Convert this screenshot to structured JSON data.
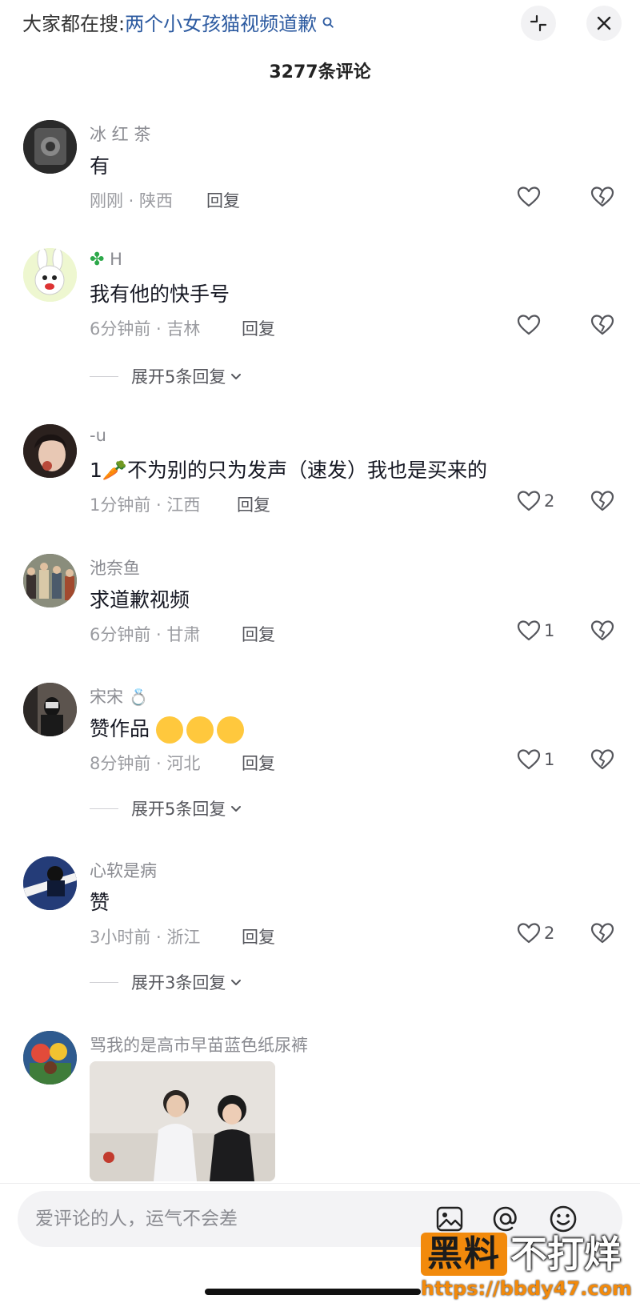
{
  "header": {
    "search_prefix": "大家都在搜:",
    "search_query": "两个小女孩猫视频道歉",
    "comments_count": "3277条评论"
  },
  "comments": [
    {
      "username": "冰 红 茶",
      "content": "有",
      "time_location": "刚刚 · 陕西",
      "reply": "回复",
      "likes": ""
    },
    {
      "username": "H",
      "content": "我有他的快手号",
      "time_location": "6分钟前 · 吉林",
      "reply": "回复",
      "likes": "",
      "expand": "展开5条回复"
    },
    {
      "username": "-u",
      "content": "1🥕不为别的只为发声（速发）我也是买来的",
      "time_location": "1分钟前 · 江西",
      "reply": "回复",
      "likes": "2"
    },
    {
      "username": "池奈鱼",
      "content": "求道歉视频",
      "time_location": "6分钟前 · 甘肃",
      "reply": "回复",
      "likes": "1"
    },
    {
      "username": "宋宋",
      "content": "赞作品",
      "time_location": "8分钟前 · 河北",
      "reply": "回复",
      "likes": "1",
      "expand": "展开5条回复"
    },
    {
      "username": "心软是病",
      "content": "赞",
      "time_location": "3小时前 · 浙江",
      "reply": "回复",
      "likes": "2",
      "expand": "展开3条回复"
    },
    {
      "username": "骂我的是高市早苗蓝色纸尿裤"
    }
  ],
  "input": {
    "placeholder": "爱评论的人，运气不会差"
  },
  "watermark": {
    "brand1": "黑料",
    "brand2": "不打烊",
    "url": "https://bbdy47.com"
  },
  "icons": {
    "collapse": "collapse-icon",
    "close": "close-icon",
    "like": "heart-icon",
    "dislike": "broken-heart-icon",
    "image": "image-icon",
    "mention": "at-icon",
    "emoji": "emoji-icon"
  }
}
